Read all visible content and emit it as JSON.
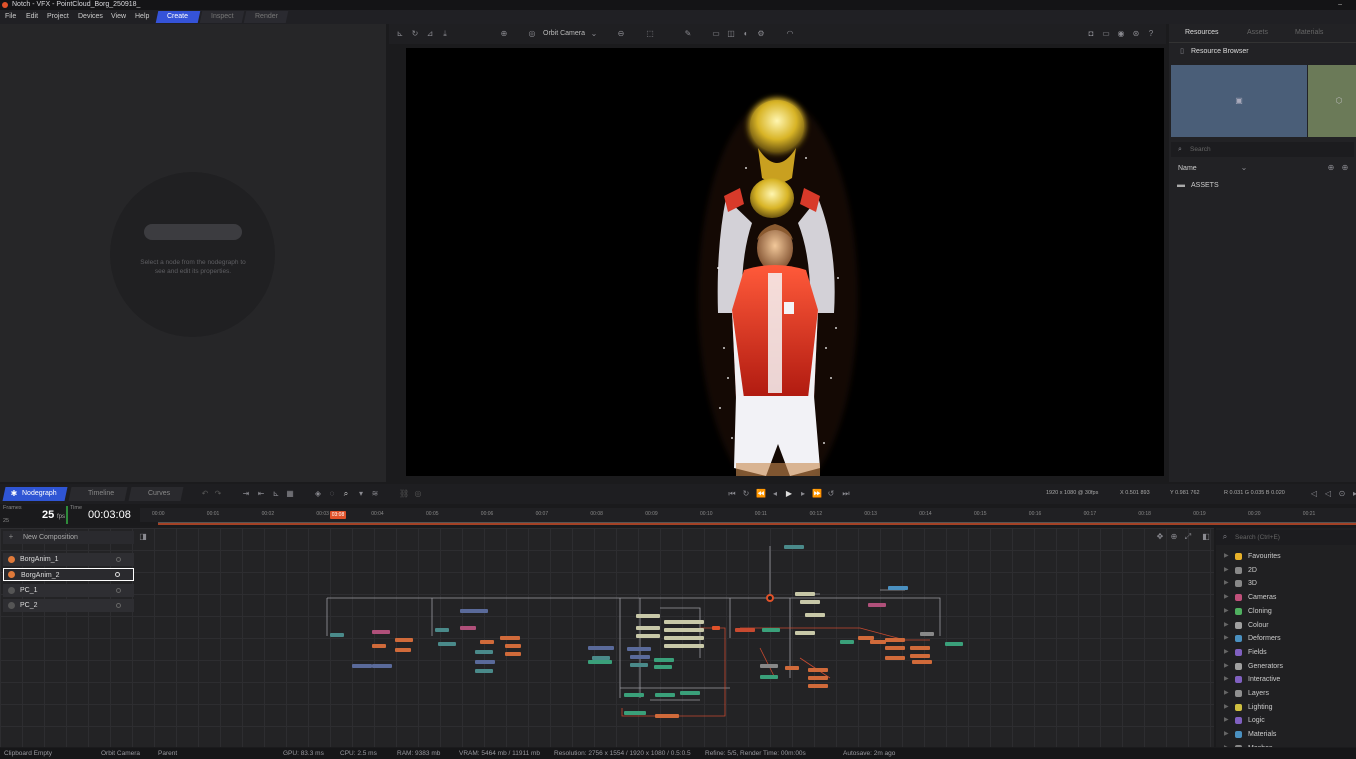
{
  "window": {
    "title": "Notch - VFX - PointCloud_Borg_250918_",
    "minimize": "–"
  },
  "menu": [
    "File",
    "Edit",
    "Project",
    "Devices",
    "View",
    "Help"
  ],
  "mode_tabs": [
    {
      "label": "Create",
      "active": true
    },
    {
      "label": "Inspect",
      "active": false
    },
    {
      "label": "Render",
      "active": false
    }
  ],
  "properties": {
    "hint": "Select a node from the nodegraph to see and edit its properties."
  },
  "viewport_toolbar": {
    "camera": "Orbit Camera"
  },
  "resources": {
    "tabs": [
      "Resources",
      "Assets",
      "Materials"
    ],
    "browser_title": "Resource Browser",
    "search_placeholder": "Search",
    "sort_label": "Name",
    "folder": "ASSETS"
  },
  "bottom_tabs": [
    {
      "label": "Nodegraph",
      "active": true
    },
    {
      "label": "Timeline",
      "active": false
    },
    {
      "label": "Curves",
      "active": false
    }
  ],
  "transport": {
    "resolution": "1920 x 1080 @ 30fps",
    "pos1": "X 0.501  893",
    "pos2": "Y 0.981  762",
    "rgb": "R 0.031  G 0.035  B 0.020"
  },
  "timeline": {
    "frames_label": "Frames",
    "time_label": "Time",
    "fps_value": "25",
    "fps_unit": "fps",
    "frame_sub": "25",
    "timecode": "00:03:08",
    "playhead": "03:08",
    "ticks": [
      "00:00",
      "00:01",
      "00:02",
      "00:03",
      "00:04",
      "00:05",
      "00:06",
      "00:07",
      "00:08",
      "00:09",
      "00:10",
      "00:11",
      "00:12",
      "00:13",
      "00:14",
      "00:15",
      "00:16",
      "00:17",
      "00:18",
      "00:19",
      "00:20",
      "00:21"
    ]
  },
  "compositions": {
    "new_label": "New Composition",
    "items": [
      {
        "name": "BorgAnim_1",
        "selected": false,
        "color": "#e07a3a"
      },
      {
        "name": "BorgAnim_2",
        "selected": true,
        "color": "#e07a3a"
      },
      {
        "name": "PC_1",
        "selected": false,
        "color": "#555555"
      },
      {
        "name": "PC_2",
        "selected": false,
        "color": "#555555"
      }
    ]
  },
  "library": {
    "search_placeholder": "Search (Ctrl+E)",
    "items": [
      {
        "label": "Favourites",
        "color": "#e8b22a"
      },
      {
        "label": "2D",
        "color": "#888888"
      },
      {
        "label": "3D",
        "color": "#888888"
      },
      {
        "label": "Cameras",
        "color": "#c0507a"
      },
      {
        "label": "Cloning",
        "color": "#50b060"
      },
      {
        "label": "Colour",
        "color": "#a0a0a0"
      },
      {
        "label": "Deformers",
        "color": "#4a90c0"
      },
      {
        "label": "Fields",
        "color": "#8060c0"
      },
      {
        "label": "Generators",
        "color": "#a0a0a0"
      },
      {
        "label": "Interactive",
        "color": "#8060c0"
      },
      {
        "label": "Layers",
        "color": "#909090"
      },
      {
        "label": "Lighting",
        "color": "#d0c040"
      },
      {
        "label": "Logic",
        "color": "#8060c0"
      },
      {
        "label": "Materials",
        "color": "#4a90c0"
      },
      {
        "label": "Meshes",
        "color": "#888888"
      }
    ]
  },
  "status": {
    "clipboard": "Clipboard Empty",
    "camera": "Orbit Camera",
    "parent": "Parent",
    "gpu": "GPU: 83.3 ms",
    "cpu": "CPU: 2.5 ms",
    "ram": "RAM: 9383 mb",
    "vram": "VRAM: 5464 mb / 11911 mb",
    "resolution": "Resolution: 2756 x 1554 / 1920 x 1080 / 0.5:0.5",
    "refine": "Refine: 5/5, Render Time: 00m:00s",
    "autosave": "Autosave: 2m ago"
  },
  "colors": {
    "accent": "#3553d8",
    "playhead": "#e0522a"
  }
}
